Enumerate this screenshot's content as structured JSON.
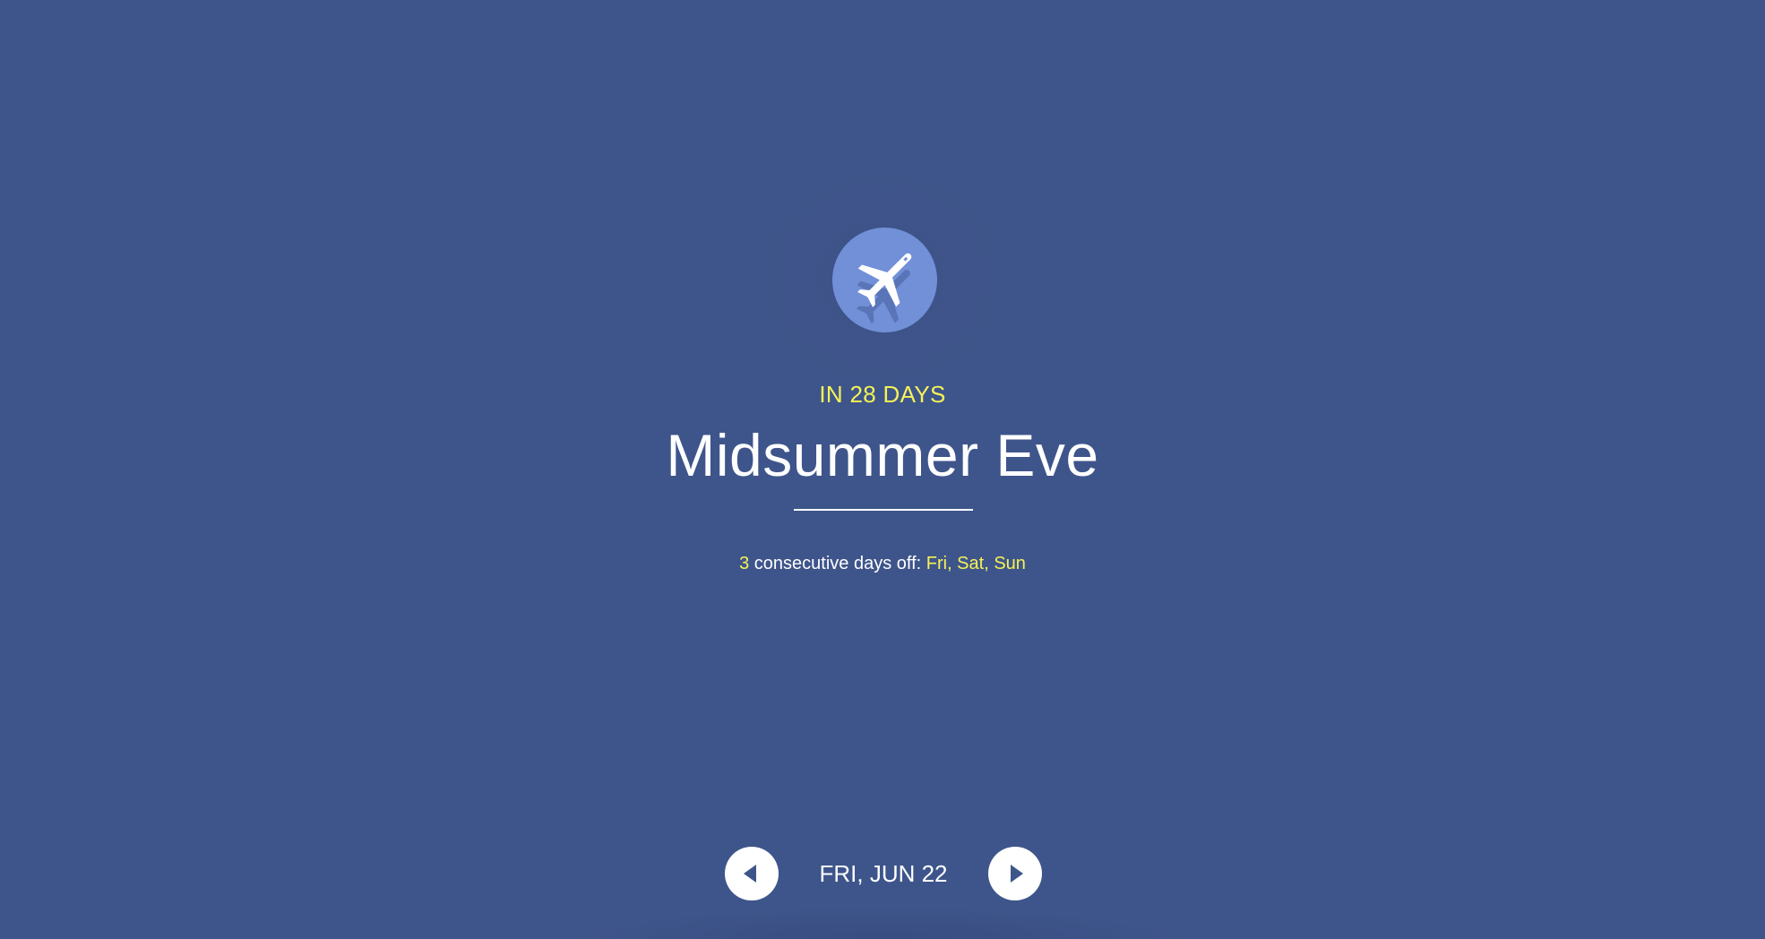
{
  "event": {
    "icon": "airplane-icon",
    "countdown": "IN 28 DAYS",
    "title": "Midsummer Eve",
    "days_off": {
      "count": "3",
      "text": " consecutive days off: ",
      "days": "Fri, Sat, Sun"
    }
  },
  "navigation": {
    "prev_icon": "arrow-left-icon",
    "next_icon": "arrow-right-icon",
    "date": "FRI, JUN 22"
  },
  "colors": {
    "background": "#3e558b",
    "accent": "#f5f256",
    "icon_circle": "#7290d8",
    "text": "#ffffff"
  }
}
